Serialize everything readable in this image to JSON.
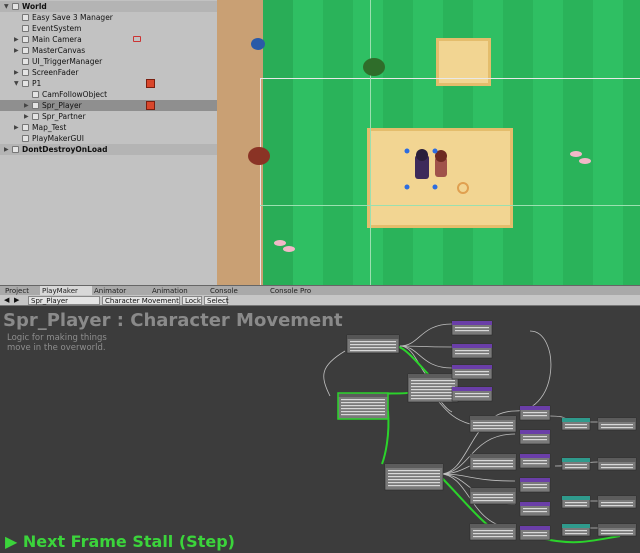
{
  "hierarchy": {
    "items": [
      {
        "label": "World",
        "depth": 0,
        "arrow": "▼",
        "type": "scene"
      },
      {
        "label": "Easy Save 3 Manager",
        "depth": 1
      },
      {
        "label": "EventSystem",
        "depth": 1
      },
      {
        "label": "Main Camera",
        "depth": 1,
        "arrow": "▶",
        "camera": true
      },
      {
        "label": "MasterCanvas",
        "depth": 1,
        "arrow": "▶"
      },
      {
        "label": "UI_TriggerManager",
        "depth": 1
      },
      {
        "label": "ScreenFader",
        "depth": 1,
        "arrow": "▶"
      },
      {
        "label": "P1",
        "depth": 1,
        "arrow": "▼",
        "badge": true
      },
      {
        "label": "CamFollowObject",
        "depth": 2
      },
      {
        "label": "Spr_Player",
        "depth": 2,
        "arrow": "▶",
        "selected": true,
        "badge": true
      },
      {
        "label": "Spr_Partner",
        "depth": 2,
        "arrow": "▶"
      },
      {
        "label": "Map_Test",
        "depth": 1,
        "arrow": "▶"
      },
      {
        "label": "PlayMakerGUI",
        "depth": 1
      },
      {
        "label": "DontDestroyOnLoad",
        "depth": 0,
        "arrow": "▶",
        "type": "scene"
      }
    ]
  },
  "tabs": [
    {
      "label": "Project",
      "active": false
    },
    {
      "label": "PlayMaker",
      "active": true
    },
    {
      "label": "Animator",
      "active": false
    },
    {
      "label": "Animation",
      "active": false
    },
    {
      "label": "Console",
      "active": false
    },
    {
      "label": "Console Pro",
      "active": false
    }
  ],
  "toolbar": {
    "object_select": "Spr_Player",
    "fsm_select": "Character Movement",
    "lock_label": "Lock",
    "select_label": "Select"
  },
  "fsm": {
    "title": "Spr_Player : Character Movement",
    "description_line1": "Logic for making things",
    "description_line2": "move in the overworld.",
    "status": "Next Frame Stall (Step)"
  },
  "colors": {
    "grass": "#2fbf63",
    "grass_dark": "#23a14e",
    "sand": "#f2d592",
    "path": "#c9a074",
    "status_green": "#3bd43b",
    "state_active": "#2bd32b",
    "state_purple": "#6a3ea8",
    "state_teal": "#2f9a8c"
  }
}
